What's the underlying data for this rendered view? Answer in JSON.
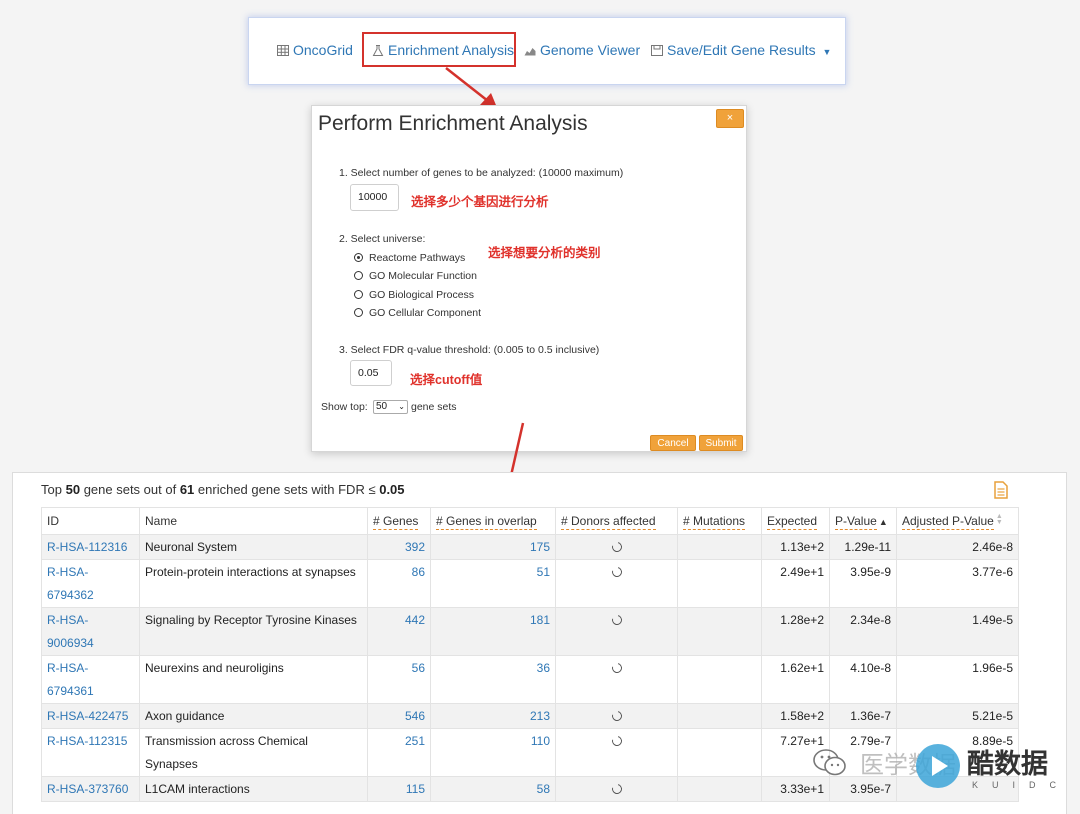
{
  "toolbar": {
    "items": [
      {
        "label": "OncoGrid",
        "icon": "grid-icon"
      },
      {
        "label": "Enrichment Analysis",
        "icon": "flask-icon"
      },
      {
        "label": "Genome Viewer",
        "icon": "area-chart-icon"
      },
      {
        "label": "Save/Edit Gene Results",
        "icon": "save-icon"
      }
    ],
    "highlight_color": "#d4322c"
  },
  "modal": {
    "title": "Perform Enrichment Analysis",
    "close_label": "×",
    "step1_label": "1. Select number of genes to be analyzed: (10000 maximum)",
    "genes_value": "10000",
    "note1": "选择多少个基因进行分析",
    "step2_label": "2. Select universe:",
    "note2": "选择想要分析的类别",
    "universe_options": [
      {
        "label": "Reactome Pathways",
        "selected": true
      },
      {
        "label": "GO Molecular Function",
        "selected": false
      },
      {
        "label": "GO Biological Process",
        "selected": false
      },
      {
        "label": "GO Cellular Component",
        "selected": false
      }
    ],
    "step3_label": "3. Select FDR q-value threshold: (0.005 to 0.5 inclusive)",
    "fdr_value": "0.05",
    "note3": "选择cutoff值",
    "show_top_prefix": "Show top:",
    "show_top_value": "50",
    "show_top_suffix": "gene sets",
    "cancel_label": "Cancel",
    "submit_label": "Submit",
    "accent_color": "#f0a23a"
  },
  "results": {
    "summary_prefix": "Top",
    "top_count": "50",
    "summary_mid": "gene sets out of",
    "total_count": "61",
    "summary_tail": "enriched gene sets with FDR ≤",
    "fdr": "0.05",
    "columns": [
      "ID",
      "Name",
      "# Genes",
      "# Genes in overlap",
      "# Donors affected",
      "# Mutations",
      "Expected",
      "P-Value",
      "Adjusted P-Value"
    ],
    "rows": [
      {
        "id": "R-HSA-112316",
        "name": "Neuronal System",
        "genes": "392",
        "overlap": "175",
        "mutations": "",
        "expected": "1.13e+2",
        "pvalue": "1.29e-11",
        "adj": "2.46e-8"
      },
      {
        "id": "R-HSA-6794362",
        "name": "Protein-protein interactions at synapses",
        "genes": "86",
        "overlap": "51",
        "mutations": "",
        "expected": "2.49e+1",
        "pvalue": "3.95e-9",
        "adj": "3.77e-6"
      },
      {
        "id": "R-HSA-9006934",
        "name": "Signaling by Receptor Tyrosine Kinases",
        "genes": "442",
        "overlap": "181",
        "mutations": "",
        "expected": "1.28e+2",
        "pvalue": "2.34e-8",
        "adj": "1.49e-5"
      },
      {
        "id": "R-HSA-6794361",
        "name": "Neurexins and neuroligins",
        "genes": "56",
        "overlap": "36",
        "mutations": "",
        "expected": "1.62e+1",
        "pvalue": "4.10e-8",
        "adj": "1.96e-5"
      },
      {
        "id": "R-HSA-422475",
        "name": "Axon guidance",
        "genes": "546",
        "overlap": "213",
        "mutations": "",
        "expected": "1.58e+2",
        "pvalue": "1.36e-7",
        "adj": "5.21e-5"
      },
      {
        "id": "R-HSA-112315",
        "name": "Transmission across Chemical Synapses",
        "genes": "251",
        "overlap": "110",
        "mutations": "",
        "expected": "7.27e+1",
        "pvalue": "2.79e-7",
        "adj": "8.89e-5"
      },
      {
        "id": "R-HSA-373760",
        "name": "L1CAM interactions",
        "genes": "115",
        "overlap": "58",
        "mutations": "",
        "expected": "3.33e+1",
        "pvalue": "3.95e-7",
        "adj": ""
      }
    ]
  },
  "watermark": {
    "text1": "医学数据",
    "text2": "酷数据",
    "sub": "KUIDC"
  }
}
